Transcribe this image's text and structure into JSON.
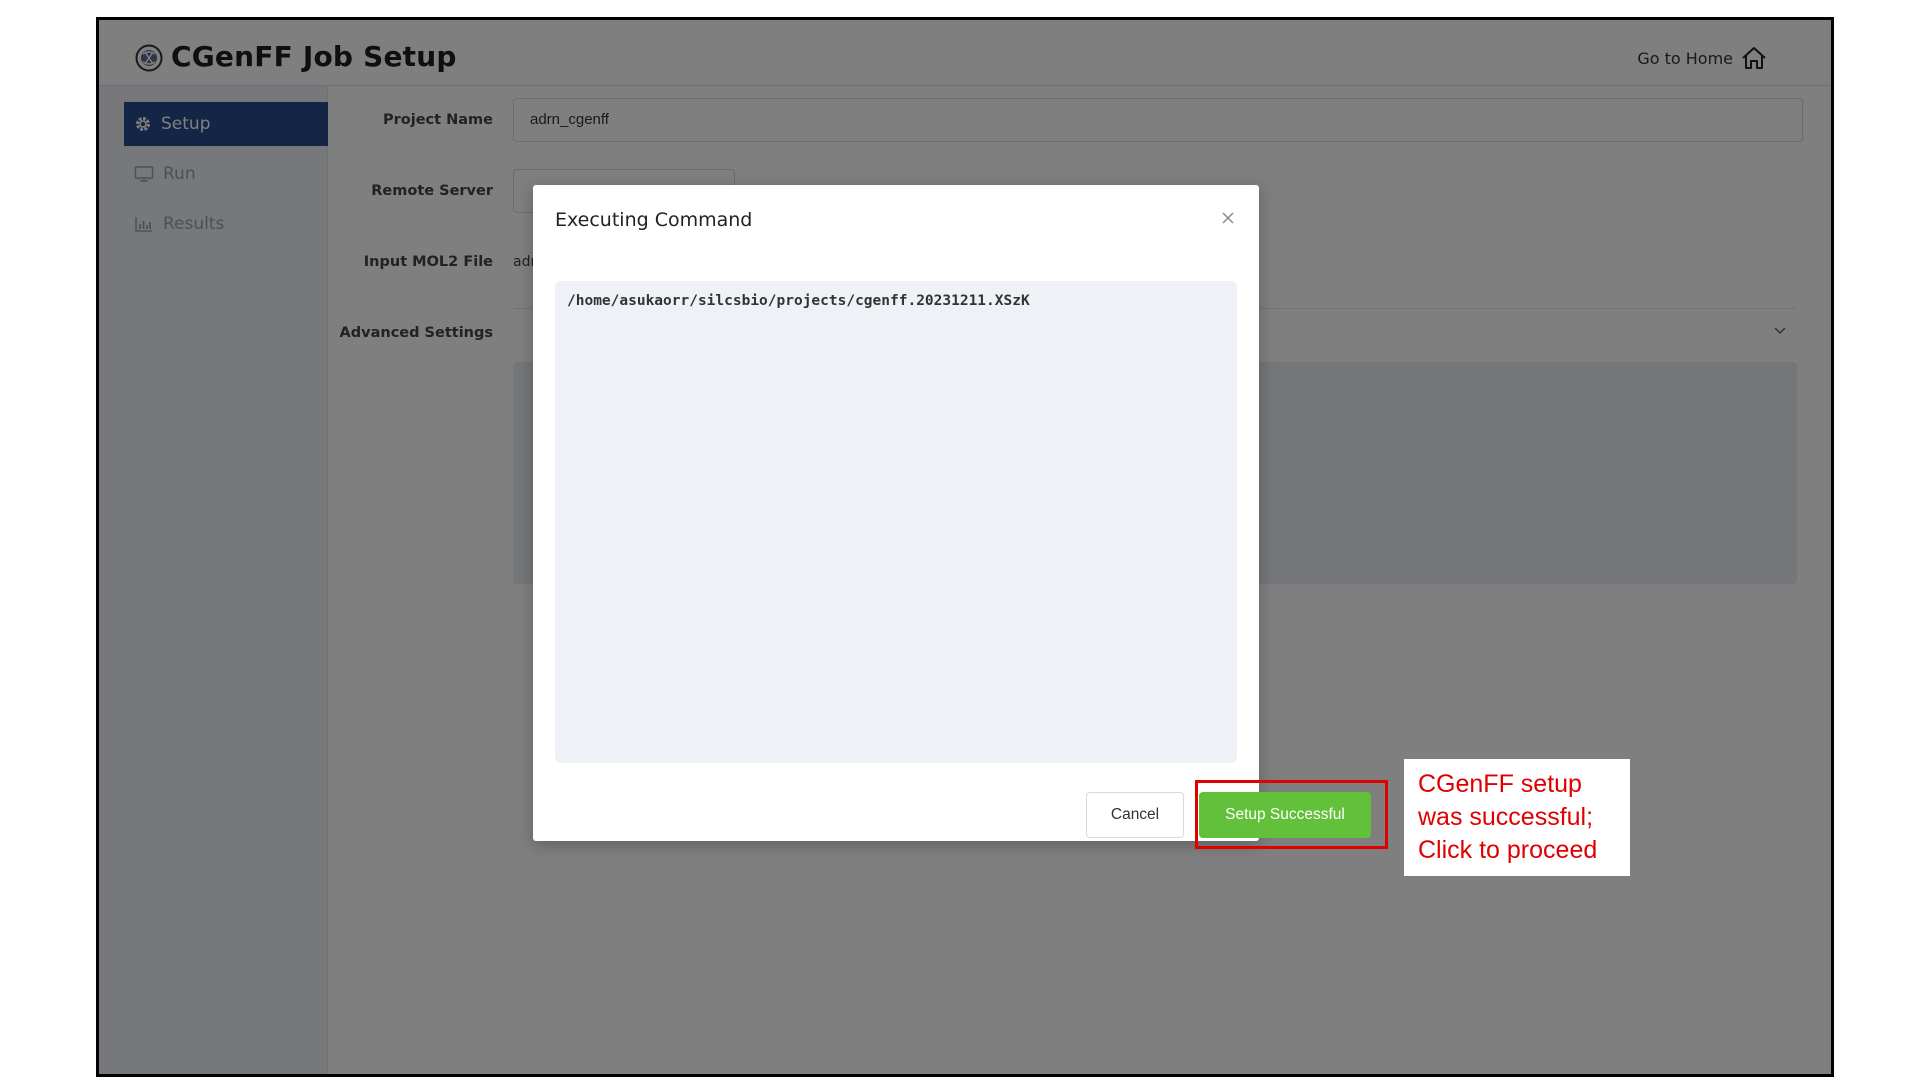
{
  "header": {
    "title": "CGenFF Job Setup",
    "home_label": "Go to Home"
  },
  "sidebar": {
    "items": [
      {
        "label": "Setup",
        "icon": "gear-icon",
        "active": true
      },
      {
        "label": "Run",
        "icon": "monitor-icon",
        "active": false
      },
      {
        "label": "Results",
        "icon": "bar-chart-icon",
        "active": false
      }
    ]
  },
  "form": {
    "project_name_label": "Project Name",
    "project_name_value": "adrn_cgenff",
    "remote_server_label": "Remote Server",
    "input_mol2_label": "Input MOL2 File",
    "input_mol2_value_partial": "adr",
    "advanced_settings_label": "Advanced Settings"
  },
  "modal": {
    "title": "Executing Command",
    "console_output": "/home/asukaorr/silcsbio/projects/cgenff.20231211.XSzK",
    "cancel_label": "Cancel",
    "success_label": "Setup Successful"
  },
  "annotation": {
    "line1": "CGenFF setup",
    "line2": "was successful;",
    "line3": "Click to proceed",
    "color": "#e00000"
  },
  "colors": {
    "accent": "#2a4a8a",
    "success": "#62c03a"
  }
}
